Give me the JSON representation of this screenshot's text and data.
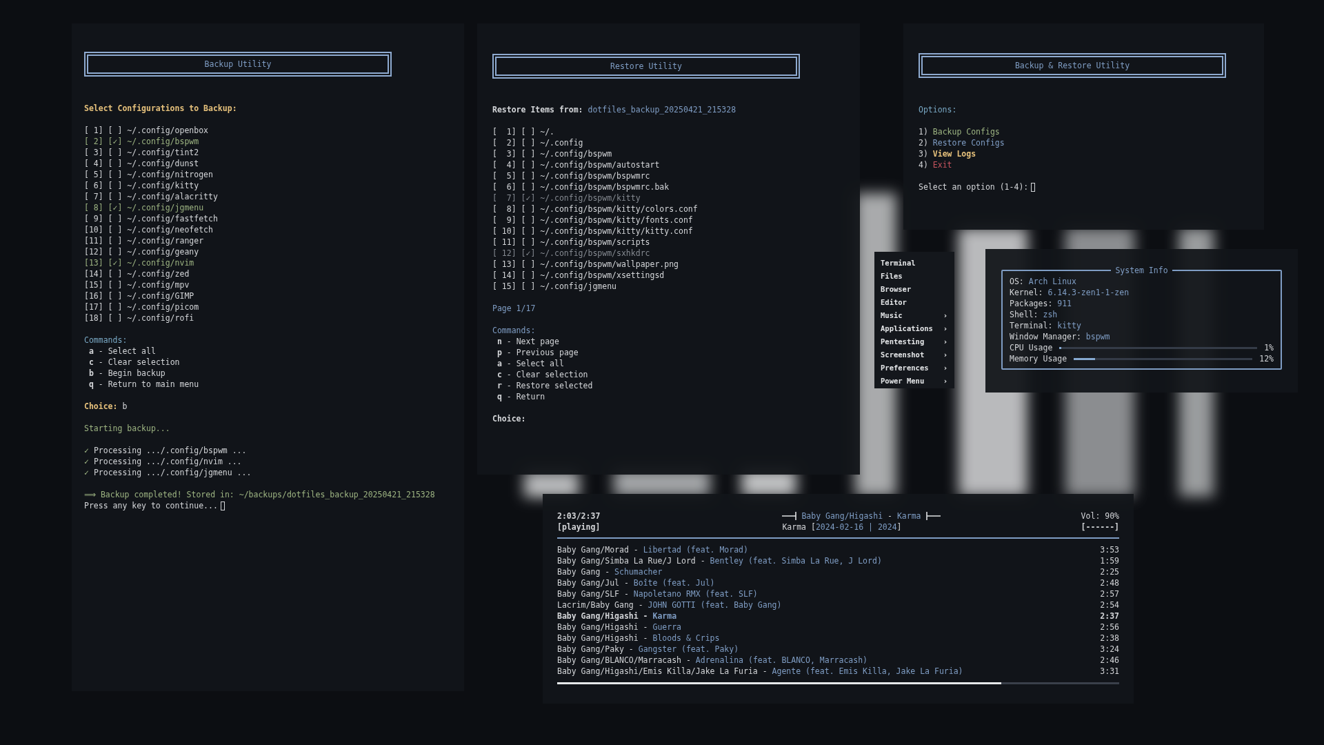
{
  "backup": {
    "title": "Backup Utility",
    "heading": "Select Configurations to Backup:",
    "items": [
      {
        "number": "[ 1]",
        "box": "[ ]",
        "path": "~/.config/openbox",
        "checked": false
      },
      {
        "number": "[ 2]",
        "box": "[✓]",
        "path": "~/.config/bspwm",
        "checked": true
      },
      {
        "number": "[ 3]",
        "box": "[ ]",
        "path": "~/.config/tint2",
        "checked": false
      },
      {
        "number": "[ 4]",
        "box": "[ ]",
        "path": "~/.config/dunst",
        "checked": false
      },
      {
        "number": "[ 5]",
        "box": "[ ]",
        "path": "~/.config/nitrogen",
        "checked": false
      },
      {
        "number": "[ 6]",
        "box": "[ ]",
        "path": "~/.config/kitty",
        "checked": false
      },
      {
        "number": "[ 7]",
        "box": "[ ]",
        "path": "~/.config/alacritty",
        "checked": false
      },
      {
        "number": "[ 8]",
        "box": "[✓]",
        "path": "~/.config/jgmenu",
        "checked": true
      },
      {
        "number": "[ 9]",
        "box": "[ ]",
        "path": "~/.config/fastfetch",
        "checked": false
      },
      {
        "number": "[10]",
        "box": "[ ]",
        "path": "~/.config/neofetch",
        "checked": false
      },
      {
        "number": "[11]",
        "box": "[ ]",
        "path": "~/.config/ranger",
        "checked": false
      },
      {
        "number": "[12]",
        "box": "[ ]",
        "path": "~/.config/geany",
        "checked": false
      },
      {
        "number": "[13]",
        "box": "[✓]",
        "path": "~/.config/nvim",
        "checked": true
      },
      {
        "number": "[14]",
        "box": "[ ]",
        "path": "~/.config/zed",
        "checked": false
      },
      {
        "number": "[15]",
        "box": "[ ]",
        "path": "~/.config/mpv",
        "checked": false
      },
      {
        "number": "[16]",
        "box": "[ ]",
        "path": "~/.config/GIMP",
        "checked": false
      },
      {
        "number": "[17]",
        "box": "[ ]",
        "path": "~/.config/picom",
        "checked": false
      },
      {
        "number": "[18]",
        "box": "[ ]",
        "path": "~/.config/rofi",
        "checked": false
      }
    ],
    "commands_heading": "Commands:",
    "commands": [
      {
        "key": "a",
        "desc": "- Select all"
      },
      {
        "key": "c",
        "desc": "- Clear selection"
      },
      {
        "key": "b",
        "desc": "- Begin backup"
      },
      {
        "key": "q",
        "desc": "- Return to main menu"
      }
    ],
    "choice_label": "Choice:",
    "choice_value": "b",
    "status": "Starting backup...",
    "processed": [
      {
        "mark": "✓",
        "text": "Processing .../.config/bspwm ..."
      },
      {
        "mark": "✓",
        "text": "Processing .../.config/nvim ..."
      },
      {
        "mark": "✓",
        "text": "Processing .../.config/jgmenu ..."
      }
    ],
    "completed": "⟹ Backup completed! Stored in: ~/backups/dotfiles_backup_20250421_215328",
    "prompt": "Press any key to continue..."
  },
  "restore": {
    "title": "Restore Utility",
    "heading_label": "Restore Items from:",
    "heading_value": "dotfiles_backup_20250421_215328",
    "items": [
      {
        "number": "[  1]",
        "box": "[ ]",
        "path": "~/.",
        "checked": false
      },
      {
        "number": "[  2]",
        "box": "[ ]",
        "path": "~/.config",
        "checked": false
      },
      {
        "number": "[  3]",
        "box": "[ ]",
        "path": "~/.config/bspwm",
        "checked": false
      },
      {
        "number": "[  4]",
        "box": "[ ]",
        "path": "~/.config/bspwm/autostart",
        "checked": false
      },
      {
        "number": "[  5]",
        "box": "[ ]",
        "path": "~/.config/bspwm/bspwmrc",
        "checked": false
      },
      {
        "number": "[  6]",
        "box": "[ ]",
        "path": "~/.config/bspwm/bspwmrc.bak",
        "checked": false
      },
      {
        "number": "[  7]",
        "box": "[✓]",
        "path": "~/.config/bspwm/kitty",
        "checked": true
      },
      {
        "number": "[  8]",
        "box": "[ ]",
        "path": "~/.config/bspwm/kitty/colors.conf",
        "checked": false
      },
      {
        "number": "[  9]",
        "box": "[ ]",
        "path": "~/.config/bspwm/kitty/fonts.conf",
        "checked": false
      },
      {
        "number": "[ 10]",
        "box": "[ ]",
        "path": "~/.config/bspwm/kitty/kitty.conf",
        "checked": false
      },
      {
        "number": "[ 11]",
        "box": "[ ]",
        "path": "~/.config/bspwm/scripts",
        "checked": false
      },
      {
        "number": "[ 12]",
        "box": "[✓]",
        "path": "~/.config/bspwm/sxhkdrc",
        "checked": true
      },
      {
        "number": "[ 13]",
        "box": "[ ]",
        "path": "~/.config/bspwm/wallpaper.png",
        "checked": false
      },
      {
        "number": "[ 14]",
        "box": "[ ]",
        "path": "~/.config/bspwm/xsettingsd",
        "checked": false
      },
      {
        "number": "[ 15]",
        "box": "[ ]",
        "path": "~/.config/jgmenu",
        "checked": false
      }
    ],
    "page": "Page 1/17",
    "commands_heading": "Commands:",
    "commands": [
      {
        "key": "n",
        "desc": "- Next page"
      },
      {
        "key": "p",
        "desc": "- Previous page"
      },
      {
        "key": "a",
        "desc": "- Select all"
      },
      {
        "key": "c",
        "desc": "- Clear selection"
      },
      {
        "key": "r",
        "desc": "- Restore selected"
      },
      {
        "key": "q",
        "desc": "- Return"
      }
    ],
    "choice_label": "Choice:"
  },
  "main_menu": {
    "title": "Backup & Restore Utility",
    "options_heading": "Options:",
    "options": [
      {
        "number": "1)",
        "label": "Backup Configs",
        "color": "#9db482",
        "selected": false
      },
      {
        "number": "2)",
        "label": "Restore Configs",
        "color": "#7f9dc4",
        "selected": false
      },
      {
        "number": "3)",
        "label": "View Logs",
        "color": "#e5c07b",
        "selected": true
      },
      {
        "number": "4)",
        "label": "Exit",
        "color": "#c8555f",
        "selected": false
      }
    ],
    "prompt": "Select an option (1-4):"
  },
  "launcher_menu": {
    "items": [
      {
        "label": "Terminal"
      },
      {
        "label": "Files"
      },
      {
        "label": "Browser"
      },
      {
        "label": "Editor"
      },
      {
        "label": "Music",
        "arrow": "›"
      },
      {
        "label": "Applications",
        "arrow": "›"
      },
      {
        "label": "Pentesting",
        "arrow": "›"
      },
      {
        "label": "Screenshot",
        "arrow": "›"
      },
      {
        "label": "Preferences",
        "arrow": "›"
      },
      {
        "label": "Power Menu",
        "arrow": "›"
      }
    ]
  },
  "system_info": {
    "title": "System Info",
    "fields": [
      {
        "label": "OS:",
        "value": "Arch Linux"
      },
      {
        "label": "Kernel:",
        "value": "6.14.3-zen1-1-zen"
      },
      {
        "label": "Packages:",
        "value": "911"
      },
      {
        "label": "Shell:",
        "value": "zsh"
      },
      {
        "label": "Terminal:",
        "value": "kitty"
      },
      {
        "label": "Window Manager:",
        "value": "bspwm"
      }
    ],
    "meters": [
      {
        "label": "CPU Usage",
        "level": 0.01,
        "reading": "1%"
      },
      {
        "label": "Memory Usage",
        "level": 0.12,
        "reading": "12%"
      }
    ]
  },
  "music_player": {
    "position": "2:03/2:37",
    "state": "[playing]",
    "now_playing": [
      {
        "text": "Baby Gang/Higashi",
        "kind": "accent"
      },
      {
        "text": " - ",
        "kind": "plain"
      },
      {
        "text": "Karma",
        "kind": "accent"
      }
    ],
    "album_line": [
      {
        "text": "Karma [",
        "kind": "plain"
      },
      {
        "text": "2024-02-16 | 2024",
        "kind": "accent"
      },
      {
        "text": "]",
        "kind": "plain"
      }
    ],
    "volume": "Vol: 90%",
    "volume_bar": "[------]",
    "tracks": [
      {
        "artist": "Baby Gang/Morad -",
        "title": "Libertad (feat. Morad)",
        "duration": "3:53",
        "selected": false
      },
      {
        "artist": "Baby Gang/Simba La Rue/J Lord -",
        "title": "Bentley (feat. Simba La Rue, J Lord)",
        "duration": "1:59",
        "selected": false
      },
      {
        "artist": "Baby Gang -",
        "title": "Schumacher",
        "duration": "2:25",
        "selected": false
      },
      {
        "artist": "Baby Gang/Jul -",
        "title": "Boîte (feat. Jul)",
        "duration": "2:48",
        "selected": false
      },
      {
        "artist": "Baby Gang/SLF -",
        "title": "Napoletano RMX (feat. SLF)",
        "duration": "2:57",
        "selected": false
      },
      {
        "artist": "Lacrim/Baby Gang -",
        "title": "JOHN GOTTI (feat. Baby Gang)",
        "duration": "2:54",
        "selected": false
      },
      {
        "artist": "Baby Gang/Higashi -",
        "title": "Karma",
        "duration": "2:37",
        "selected": true
      },
      {
        "artist": "Baby Gang/Higashi -",
        "title": "Guerra",
        "duration": "2:56",
        "selected": false
      },
      {
        "artist": "Baby Gang/Higashi -",
        "title": "Bloods & Crips",
        "duration": "2:38",
        "selected": false
      },
      {
        "artist": "Baby Gang/Paky -",
        "title": "Gangster (feat. Paky)",
        "duration": "3:24",
        "selected": false
      },
      {
        "artist": "Baby Gang/BLANCO/Marracash -",
        "title": "Adrenalina (feat. BLANCO, Marracash)",
        "duration": "2:46",
        "selected": false
      },
      {
        "artist": "Baby Gang/Higashi/Emis Killa/Jake La Furia -",
        "title": "Agente (feat. Emis Killa, Jake La Furia)",
        "duration": "3:31",
        "selected": false
      }
    ],
    "progress": {
      "level": 0.79
    }
  }
}
